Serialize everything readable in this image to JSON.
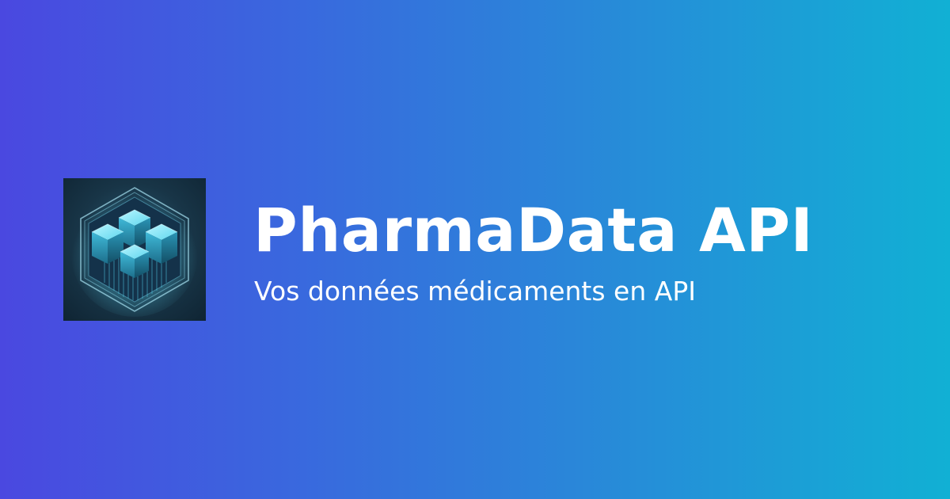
{
  "brand": {
    "title": "PharmaData API",
    "tagline": "Vos données médicaments en API",
    "logo_icon": "hexagon-data-cubes-icon"
  },
  "colors": {
    "gradient_start": "#4a48e0",
    "gradient_end": "#11b0d4",
    "text": "#ffffff",
    "logo_background": "#183547",
    "logo_accent": "#5fe0f5"
  }
}
